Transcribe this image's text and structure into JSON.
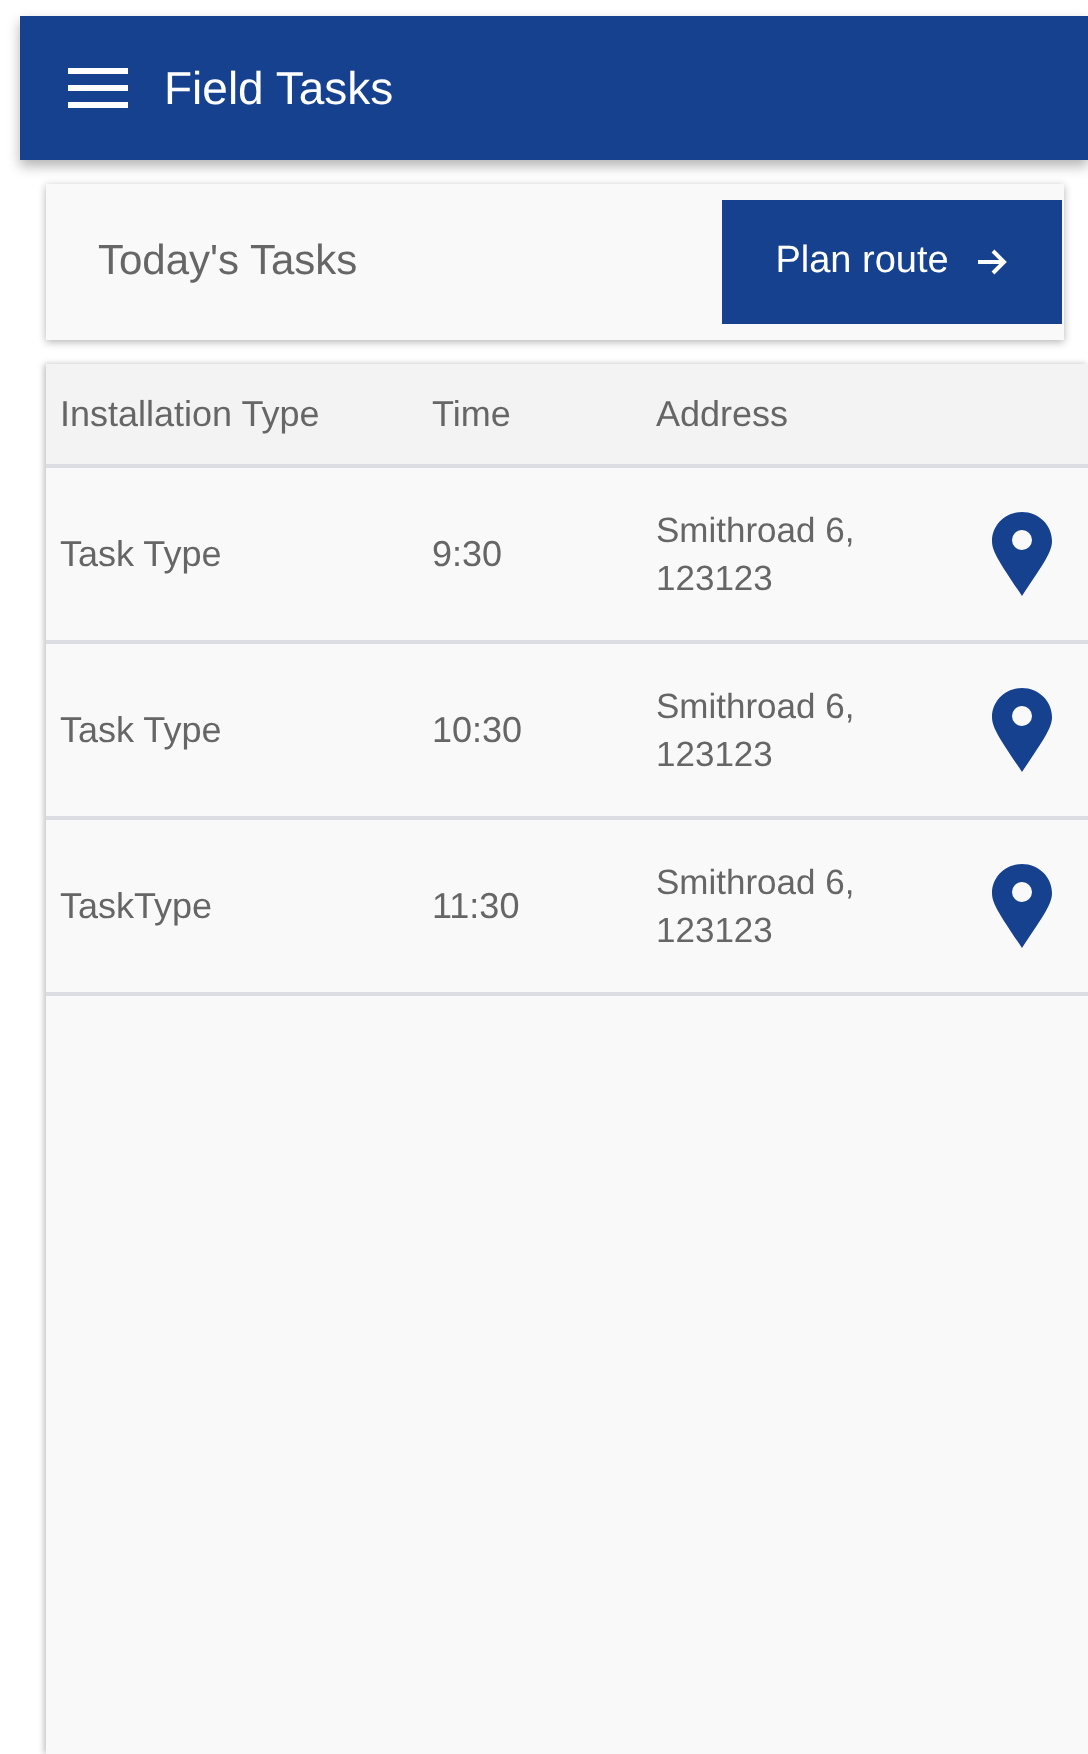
{
  "app_bar": {
    "title": "Field Tasks"
  },
  "header_card": {
    "title": "Today's Tasks",
    "button": "Plan route"
  },
  "table": {
    "columns": [
      "Installation Type",
      "Time",
      "Address"
    ],
    "rows": [
      {
        "type": "Task Type",
        "time": "9:30",
        "address": "Smithroad 6, 123123"
      },
      {
        "type": "Task Type",
        "time": "10:30",
        "address": "Smithroad 6, 123123"
      },
      {
        "type": "TaskType",
        "time": "11:30",
        "address": "Smithroad 6, 123123"
      }
    ]
  }
}
